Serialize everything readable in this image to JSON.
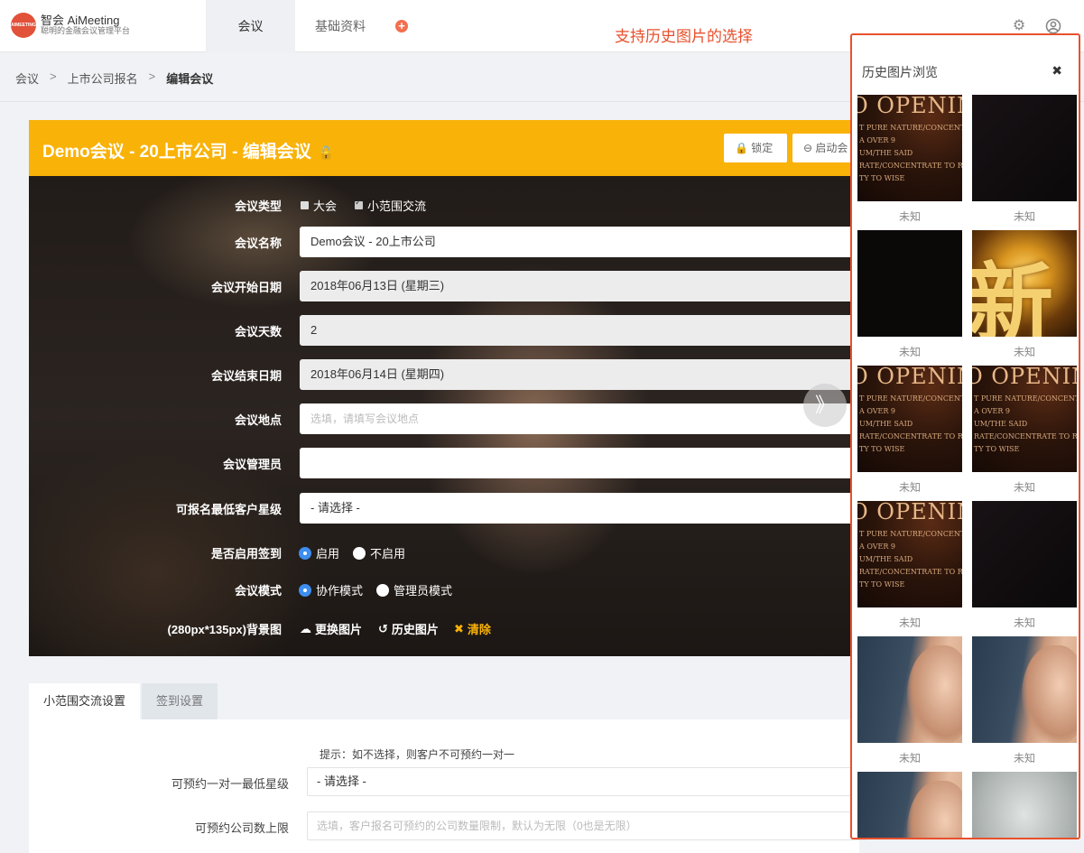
{
  "header": {
    "logo_mark": "AIMEETING",
    "logo_title": "智会 AiMeeting",
    "logo_sub": "聪明的金融会议管理平台",
    "nav": [
      {
        "label": "会议",
        "active": true
      },
      {
        "label": "基础资料",
        "active": false
      }
    ],
    "annotation": "支持历史图片的选择",
    "icons": [
      "add-icon",
      "gear-icon",
      "user-icon"
    ]
  },
  "breadcrumb": {
    "items": [
      "会议",
      "上市公司报名",
      "编辑会议"
    ],
    "separator": ">"
  },
  "card": {
    "title": "Demo会议 - 20上市公司 - 编辑会议",
    "lock_button": "锁定",
    "start_button": "启动会",
    "accent": "#f9b208"
  },
  "form": {
    "type_label": "会议类型",
    "type_options": [
      {
        "label": "大会",
        "checked": false
      },
      {
        "label": "小范围交流",
        "checked": true
      }
    ],
    "name_label": "会议名称",
    "name_value": "Demo会议 - 20上市公司",
    "start_label": "会议开始日期",
    "start_value": "2018年06月13日 (星期三)",
    "days_label": "会议天数",
    "days_value": "2",
    "end_label": "会议结束日期",
    "end_value": "2018年06月14日 (星期四)",
    "location_label": "会议地点",
    "location_placeholder": "选填，请填写会议地点",
    "admin_label": "会议管理员",
    "admin_value": "",
    "star_label": "可报名最低客户星级",
    "star_value": "- 请选择 -",
    "checkin_label": "是否启用签到",
    "checkin_options": [
      {
        "label": "启用",
        "checked": true
      },
      {
        "label": "不启用",
        "checked": false
      }
    ],
    "mode_label": "会议模式",
    "mode_options": [
      {
        "label": "协作模式",
        "checked": true
      },
      {
        "label": "管理员模式",
        "checked": false
      }
    ],
    "bg_label": "(280px*135px)背景图",
    "bg_actions": {
      "change": "更换图片",
      "history": "历史图片",
      "clear": "清除"
    }
  },
  "tabs": [
    {
      "label": "小范围交流设置",
      "active": true
    },
    {
      "label": "签到设置",
      "active": false
    }
  ],
  "panel": {
    "hint": "提示：如不选择，则客户不可预约一对一",
    "min_star_label": "可预约一对一最低星级",
    "min_star_value": "- 请选择 -",
    "limit_label": "可预约公司数上限",
    "limit_placeholder": "选填，客户报名可预约的公司数量限制，默认为无限（0也是无限）"
  },
  "history": {
    "title": "历史图片浏览",
    "close_icon": "close-icon",
    "opening_big": "O OPENIN",
    "opening_lines": [
      "T PURE NATURE/CONCENT",
      "A OVER 9",
      "UM/THE SAID",
      "RATE/CONCENTRATE TO RETURN",
      "TY TO WISE"
    ],
    "gold_char": "新",
    "images": [
      {
        "style": "opening",
        "caption": "未知"
      },
      {
        "style": "dark",
        "caption": "未知"
      },
      {
        "style": "darker",
        "caption": "未知"
      },
      {
        "style": "gold",
        "caption": "未知"
      },
      {
        "style": "opening",
        "caption": "未知"
      },
      {
        "style": "opening",
        "caption": "未知"
      },
      {
        "style": "opening",
        "caption": "未知"
      },
      {
        "style": "dark",
        "caption": "未知"
      },
      {
        "style": "face",
        "caption": "未知"
      },
      {
        "style": "face",
        "caption": "未知"
      },
      {
        "style": "face",
        "caption": ""
      },
      {
        "style": "grey",
        "caption": ""
      }
    ]
  }
}
